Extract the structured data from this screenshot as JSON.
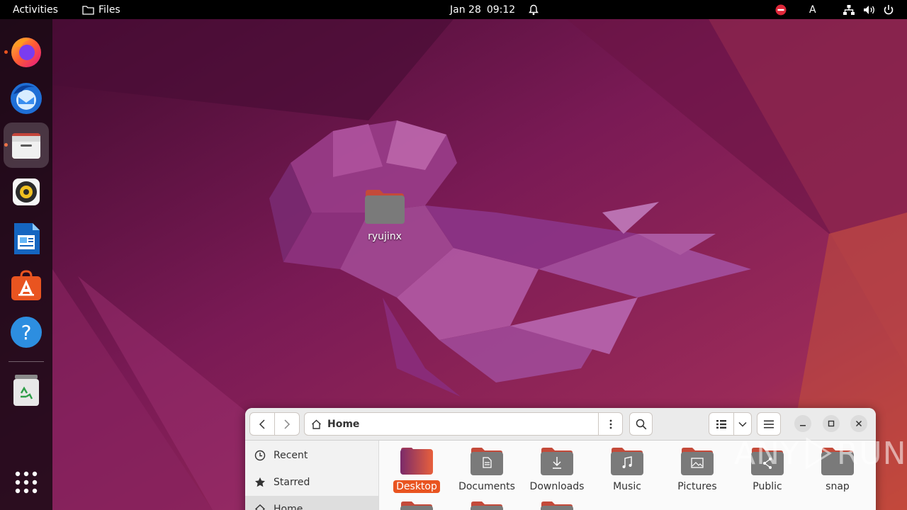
{
  "topbar": {
    "activities_label": "Activities",
    "app_name": "Files",
    "date": "Jan 28",
    "time": "09:12",
    "keyboard_indicator": "A"
  },
  "dock": {
    "items": [
      {
        "name": "Firefox",
        "icon": "firefox-icon",
        "running": true
      },
      {
        "name": "Thunderbird",
        "icon": "thunderbird-icon",
        "running": false
      },
      {
        "name": "Files",
        "icon": "files-icon",
        "running": true,
        "active": true
      },
      {
        "name": "Rhythmbox",
        "icon": "rhythmbox-icon",
        "running": false
      },
      {
        "name": "LibreOffice Writer",
        "icon": "writer-icon",
        "running": false
      },
      {
        "name": "Ubuntu Software",
        "icon": "software-icon",
        "running": false
      },
      {
        "name": "Help",
        "icon": "help-icon",
        "running": false
      },
      {
        "name": "Trash",
        "icon": "trash-icon",
        "running": false
      },
      {
        "name": "Show Applications",
        "icon": "app-grid-icon",
        "running": false
      }
    ]
  },
  "desktop": {
    "folder_label": "ryujinx"
  },
  "files_window": {
    "path_label": "Home",
    "sidebar": [
      {
        "label": "Recent",
        "icon": "clock-icon"
      },
      {
        "label": "Starred",
        "icon": "star-icon"
      },
      {
        "label": "Home",
        "icon": "home-icon",
        "selected": true
      }
    ],
    "items": [
      {
        "label": "Desktop",
        "icon": "desktop-folder-icon",
        "selected": true
      },
      {
        "label": "Documents",
        "icon": "documents-folder-icon"
      },
      {
        "label": "Downloads",
        "icon": "downloads-folder-icon"
      },
      {
        "label": "Music",
        "icon": "music-folder-icon"
      },
      {
        "label": "Pictures",
        "icon": "pictures-folder-icon"
      },
      {
        "label": "Public",
        "icon": "public-folder-icon"
      },
      {
        "label": "snap",
        "icon": "folder-icon"
      }
    ]
  },
  "watermark": {
    "text_left": "ANY",
    "text_right": "RUN"
  },
  "colors": {
    "accent": "#e95420",
    "topbar": "#000000",
    "folder_body": "#7a7a7a",
    "folder_tab": "#c44a3a"
  }
}
